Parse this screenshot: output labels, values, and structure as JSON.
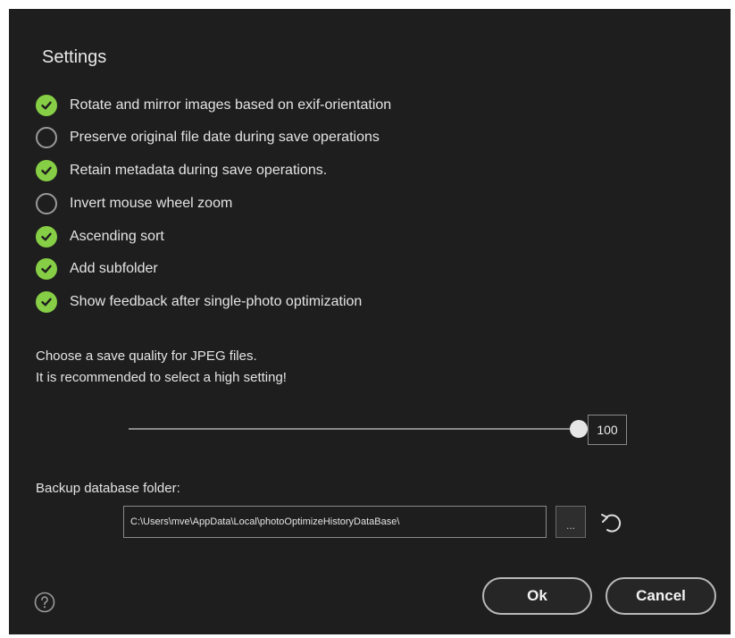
{
  "dialog": {
    "title": "Settings"
  },
  "options": [
    {
      "label": "Rotate and mirror images based on exif-orientation",
      "checked": true
    },
    {
      "label": "Preserve original file date during save operations",
      "checked": false
    },
    {
      "label": "Retain metadata during save operations.",
      "checked": true
    },
    {
      "label": "Invert mouse wheel zoom",
      "checked": false
    },
    {
      "label": "Ascending sort",
      "checked": true
    },
    {
      "label": "Add subfolder",
      "checked": true
    },
    {
      "label": "Show feedback after single-photo optimization",
      "checked": true
    }
  ],
  "quality": {
    "description_line1": "Choose a save quality for JPEG files.",
    "description_line2": "It is recommended to select a high setting!",
    "value": "100",
    "slider_fraction": 1.0
  },
  "backup": {
    "label": "Backup database folder:",
    "path": "C:\\Users\\mve\\AppData\\Local\\photoOptimizeHistoryDataBase\\",
    "browse_label": "...",
    "reset_icon": "undo-icon"
  },
  "footer": {
    "help_icon": "help-icon",
    "ok_label": "Ok",
    "cancel_label": "Cancel"
  },
  "colors": {
    "background": "#1e1e1e",
    "check_accent": "#86ce45",
    "text": "#e4e4e4"
  }
}
